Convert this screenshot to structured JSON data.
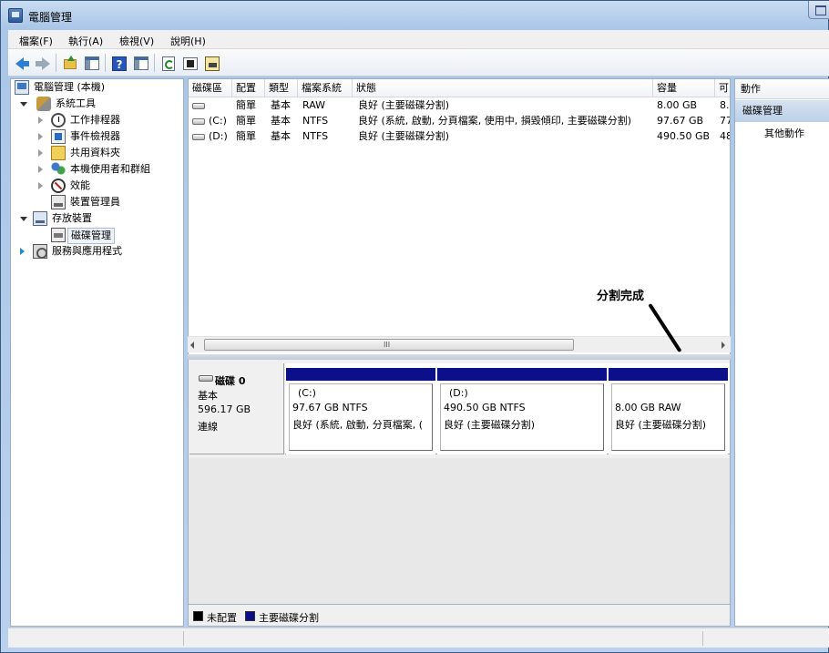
{
  "window": {
    "title": "電腦管理"
  },
  "menu": [
    "檔案(F)",
    "執行(A)",
    "檢視(V)",
    "說明(H)"
  ],
  "tree": {
    "root": "電腦管理 (本機)",
    "system_tools": "系統工具",
    "task_scheduler": "工作排程器",
    "event_viewer": "事件檢視器",
    "shared_folders": "共用資料夾",
    "local_users": "本機使用者和群組",
    "performance": "效能",
    "device_manager": "裝置管理員",
    "storage": "存放裝置",
    "disk_management": "磁碟管理",
    "services": "服務與應用程式"
  },
  "volume_list": {
    "columns": [
      "磁碟區",
      "配置",
      "類型",
      "檔案系統",
      "狀態",
      "容量",
      "可"
    ],
    "rows": [
      {
        "volume": "",
        "layout": "簡單",
        "type": "基本",
        "fs": "RAW",
        "status": "良好 (主要磁碟分割)",
        "capacity": "8.00 GB",
        "free": "8."
      },
      {
        "volume": "(C:)",
        "layout": "簡單",
        "type": "基本",
        "fs": "NTFS",
        "status": "良好 (系統, 啟動, 分頁檔案, 使用中, 損毀傾印, 主要磁碟分割)",
        "capacity": "97.67 GB",
        "free": "77"
      },
      {
        "volume": "(D:)",
        "layout": "簡單",
        "type": "基本",
        "fs": "NTFS",
        "status": "良好 (主要磁碟分割)",
        "capacity": "490.50 GB",
        "free": "48"
      }
    ],
    "scroll_grip": "III"
  },
  "disk": {
    "name": "磁碟 0",
    "kind": "基本",
    "size": "596.17 GB",
    "state": "連線",
    "partitions": [
      {
        "label": "(C:)",
        "size_fs": "97.67 GB NTFS",
        "status": "良好 (系統, 啟動, 分頁檔案, ("
      },
      {
        "label": "(D:)",
        "size_fs": "490.50 GB NTFS",
        "status": "良好 (主要磁碟分割)"
      },
      {
        "label": "",
        "size_fs": "8.00 GB RAW",
        "status": "良好 (主要磁碟分割)"
      }
    ]
  },
  "legend": {
    "unallocated": "未配置",
    "primary": "主要磁碟分割",
    "unallocated_color": "#000000",
    "primary_color": "#0c0f8a"
  },
  "actions": {
    "header": "動作",
    "section": "磁碟管理",
    "more": "其他動作"
  },
  "annotation": "分割完成"
}
